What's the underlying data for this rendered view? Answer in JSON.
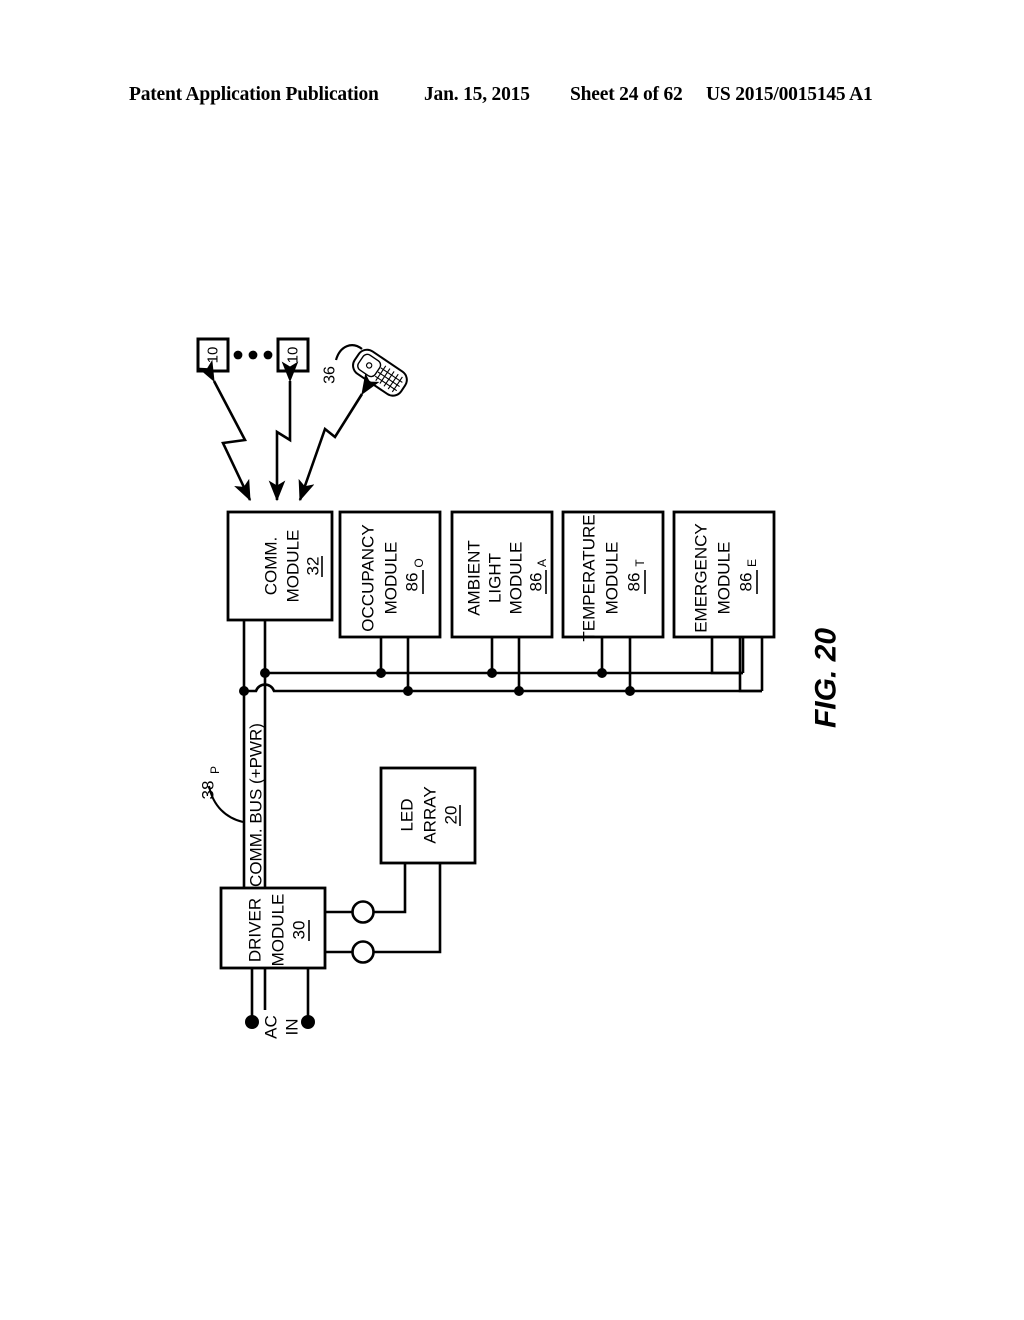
{
  "header": {
    "publication": "Patent Application Publication",
    "date": "Jan. 15, 2015",
    "sheet": "Sheet 24 of 62",
    "patent_number": "US 2015/0015145 A1"
  },
  "figure": {
    "label": "FIG. 20",
    "nodes": {
      "luminaire_a": {
        "ref": "10"
      },
      "luminaire_b": {
        "ref": "10"
      },
      "ellipsis": "• • •",
      "mobile_device": {
        "ref": "36"
      },
      "comm_module": {
        "line1": "COMM.",
        "line2": "MODULE",
        "ref": "32"
      },
      "occupancy_module": {
        "line1": "OCCUPANCY",
        "line2": "MODULE",
        "ref": "86",
        "sub": "O"
      },
      "ambient_light_module": {
        "line1": "AMBIENT",
        "line2": "LIGHT",
        "line3": "MODULE",
        "ref": "86",
        "sub": "A"
      },
      "temperature_module": {
        "line1": "TEMPERATURE",
        "line2": "MODULE",
        "ref": "86",
        "sub": "T"
      },
      "emergency_module": {
        "line1": "EMERGENCY",
        "line2": "MODULE",
        "ref": "86",
        "sub": "E"
      },
      "driver_module": {
        "line1": "DRIVER",
        "line2": "MODULE",
        "ref": "30"
      },
      "led_array": {
        "line1": "LED",
        "line2": "ARRAY",
        "ref": "20"
      }
    },
    "annotations": {
      "comm_bus": "COMM. BUS (+PWR)",
      "comm_bus_ref": "38",
      "comm_bus_ref_sub": "P",
      "ac_in_line1": "AC",
      "ac_in_line2": "IN"
    }
  },
  "colors": {
    "ink": "#000000",
    "paper": "#ffffff"
  }
}
